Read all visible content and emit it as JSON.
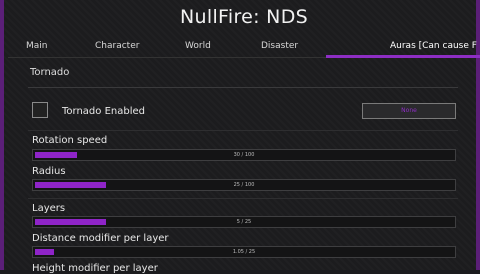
{
  "window": {
    "title": "NullFire: NDS"
  },
  "tabs": [
    {
      "label": "Main"
    },
    {
      "label": "Character"
    },
    {
      "label": "World"
    },
    {
      "label": "Disaster"
    },
    {
      "label": "Auras [Can cause F"
    }
  ],
  "section": {
    "title": "Tornado"
  },
  "toggle": {
    "label": "Tornado Enabled",
    "key_label": "None"
  },
  "sliders": [
    {
      "label": "Rotation speed",
      "value_text": "30 / 100",
      "fraction": 0.1
    },
    {
      "label": "Radius",
      "value_text": "25 / 100",
      "fraction": 0.17
    },
    {
      "label": "Layers",
      "value_text": "5 / 25",
      "fraction": 0.17
    },
    {
      "label": "Distance modifier per layer",
      "value_text": "1.05 / 25",
      "fraction": 0.045
    },
    {
      "label": "Height modifier per layer"
    }
  ],
  "colors": {
    "accent": "#8f24c8",
    "border": "#5b1f78",
    "background": "#1c1c1e"
  }
}
